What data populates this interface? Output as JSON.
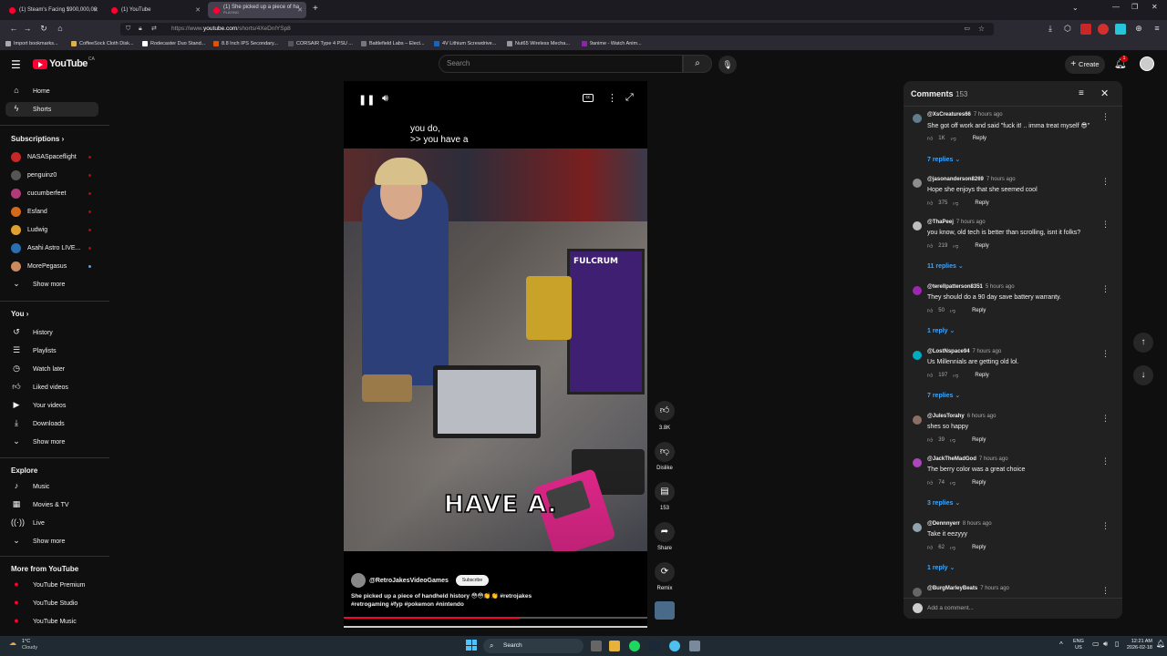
{
  "browser": {
    "tabs": [
      {
        "label": "(1) Steam's Facing $900,000,00"
      },
      {
        "label": "(1) YouTube"
      },
      {
        "label": "(1) She picked up a piece of ha",
        "sub": "PLAYING"
      }
    ],
    "url_prefix": "https://www.",
    "url_domain": "youtube.com",
    "url_path": "/shorts/4XeDnlYSp8",
    "bookmarks": [
      "Import bookmarks...",
      "CoffeeSock Cloth Disk...",
      "Rodecaster Duo Stand...",
      "8.8 Inch IPS Secondary...",
      "CORSAIR Type 4 PSU ...",
      "Battlefield Labs – Elect...",
      "4V Lithium Screwdrive...",
      "Nut65 Wireless Mecha...",
      "9anime - Watch Anim..."
    ]
  },
  "header": {
    "logo": "YouTube",
    "region": "CA",
    "search_placeholder": "Search",
    "create_label": "Create",
    "notif_count": "1"
  },
  "sidebar": {
    "main": [
      {
        "label": "Home",
        "icon": "home-icon"
      },
      {
        "label": "Shorts",
        "icon": "shorts-icon"
      }
    ],
    "subs_title": "Subscriptions",
    "subs": [
      {
        "label": "NASASpaceflight",
        "color": "#c62828"
      },
      {
        "label": "penguinz0",
        "color": "#555555"
      },
      {
        "label": "cucumberfeet",
        "color": "#b03a7a"
      },
      {
        "label": "Esfand",
        "color": "#d2691e"
      },
      {
        "label": "Ludwig",
        "color": "#e0a030"
      },
      {
        "label": "Asahi Astro LIVE...",
        "color": "#2a6fb0"
      },
      {
        "label": "MorePegasus",
        "color": "#c98a60"
      }
    ],
    "show_more": "Show more",
    "you_title": "You",
    "you": [
      {
        "label": "History",
        "icon": "history-icon"
      },
      {
        "label": "Playlists",
        "icon": "playlists-icon"
      },
      {
        "label": "Watch later",
        "icon": "clock-icon"
      },
      {
        "label": "Liked videos",
        "icon": "thumbs-up-icon"
      },
      {
        "label": "Your videos",
        "icon": "video-icon"
      },
      {
        "label": "Downloads",
        "icon": "download-icon"
      }
    ],
    "explore_title": "Explore",
    "explore": [
      {
        "label": "Music",
        "icon": "music-icon"
      },
      {
        "label": "Movies & TV",
        "icon": "film-icon"
      },
      {
        "label": "Live",
        "icon": "live-icon"
      }
    ],
    "more_title": "More from YouTube",
    "more": [
      {
        "label": "YouTube Premium"
      },
      {
        "label": "YouTube Studio"
      },
      {
        "label": "YouTube Music"
      }
    ]
  },
  "video": {
    "caption_line1": "you do,",
    "caption_line2": ">> you have a",
    "big_caption": "HAVE A.",
    "channel": "@RetroJakesVideoGames",
    "subscribe": "Subscribe",
    "description_line1": "She picked up a piece of handheld history 😳😳👏👏 #retrojakes",
    "description_line2": "#retrogaming #fyp #pokemon #nintendo",
    "progress": 0.58,
    "likes": "3.8K",
    "dislike": "Dislike",
    "comments_count": "153",
    "share": "Share",
    "remix": "Remix"
  },
  "comments": {
    "title": "Comments",
    "count": "153",
    "add_placeholder": "Add a comment...",
    "items": [
      {
        "author": "@XsCreatures66",
        "time": "7 hours ago",
        "text": "She got off work and said \"fuck it! .. imma treat myself 😎\"",
        "likes": "1K",
        "replies": "7 replies",
        "color": "#607d8b"
      },
      {
        "author": "@jasonanderson8269",
        "time": "7 hours ago",
        "text": "Hope she enjoys that she seemed cool",
        "likes": "375",
        "replies": "",
        "color": "#8d8d8d"
      },
      {
        "author": "@ThaPeej",
        "time": "7 hours ago",
        "text": "you know, old tech is better than scrolling, isnt it folks?",
        "likes": "219",
        "replies": "11 replies",
        "color": "#bdbdbd"
      },
      {
        "author": "@terellpatterson8351",
        "time": "5 hours ago",
        "text": "They should do a 90 day save battery warranty.",
        "likes": "50",
        "replies": "1 reply",
        "color": "#9c27b0"
      },
      {
        "author": "@LostNspace94",
        "time": "7 hours ago",
        "text": "Us Millennials are getting old lol.",
        "likes": "197",
        "replies": "7 replies",
        "color": "#00acc1"
      },
      {
        "author": "@JulesTorahy",
        "time": "6 hours ago",
        "text": "shes so happy",
        "likes": "39",
        "replies": "",
        "color": "#8d6e63"
      },
      {
        "author": "@JackTheMadGod",
        "time": "7 hours ago",
        "text": "The berry color was a great choice",
        "likes": "74",
        "replies": "3 replies",
        "color": "#ab47bc"
      },
      {
        "author": "@Dennnyerr",
        "time": "8 hours ago",
        "text": "Take it eezyyy",
        "likes": "62",
        "replies": "1 reply",
        "color": "#90a4ae"
      },
      {
        "author": "@BurgMarleyBeats",
        "time": "7 hours ago",
        "text": "",
        "likes": "",
        "replies": "",
        "color": "#666666"
      }
    ],
    "reply_label": "Reply"
  },
  "taskbar": {
    "weather_temp": "1°C",
    "weather_desc": "Cloudy",
    "search": "Search",
    "lang1": "ENG",
    "lang2": "US",
    "time": "12:21 AM",
    "date": "2026-02-18"
  }
}
